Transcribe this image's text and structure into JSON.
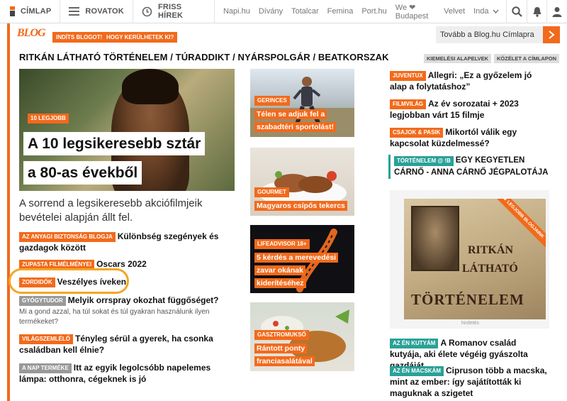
{
  "topnav": {
    "cimlap": "CÍMLAP",
    "rovatok": "ROVATOK",
    "friss": "FRISS HÍREK",
    "sites": [
      "Napi.hu",
      "Dívány",
      "Totalcar",
      "Femina",
      "Port.hu",
      "We ❤ Budapest",
      "Velvet",
      "Inda"
    ]
  },
  "header": {
    "logo": "BLOG",
    "start_blog": "INDÍTS BLOGOT!",
    "how_to": "HOGY KERÜLHETEK KI?",
    "cimlap_link": "Tovább a Blog.hu Címlapra",
    "categories": "RITKÁN LÁTHATÓ TÖRTÉNELEM / TÚRADDIKT / NYÁRSPOLGÁR / BEATKORSZAK",
    "filter1": "KIEMELÉSI ALAPELVEK",
    "filter2": "KÖZÉLET A CÍMLAPON"
  },
  "hero": {
    "tag": "10 LEGJOBB",
    "line1": "A 10 legsikeresebb sztár",
    "line2": "a 80-as évekből",
    "desc": "A sorrend a legsikeresebb akciófilmjeik bevételei alapján állt fel."
  },
  "left_list": [
    {
      "tag": "AZ ANYAGI BIZTONSÁG BLOGJA",
      "title": "Különbség szegények és gazdagok között"
    },
    {
      "tag": "ZUPASTA FILMÉLMÉNYEI",
      "title": "Oscars 2022"
    },
    {
      "tag": "ZORDIDŐK",
      "title": "Veszélyes íveken"
    },
    {
      "tag": "GYÓGYTUDOR",
      "title": "Melyik orrspray okozhat függőséget?",
      "sub": "Mi a gond azzal, ha túl sokat és túl gyakran használunk ilyen termékeket?"
    },
    {
      "tag": "VILÁGSZEMLÉLŐ",
      "title": "Tényleg sérül a gyerek, ha csonka családban kell élnie?"
    },
    {
      "tag": "A NAP TERMÉKE",
      "title": "Itt az egyik legolcsóbb napelemes lámpa: otthonra, cégeknek is jó"
    }
  ],
  "cards": [
    {
      "tag": "GERINCES",
      "title": "Télen se adjuk fel a szabadtéri sportolást!"
    },
    {
      "tag": "GOURMET",
      "title": "Magyaros csípős tekercs"
    },
    {
      "tag": "LIFEADVISOR 18+",
      "title": "5 kérdés a merevedési zavar okának kiderítéséhez"
    },
    {
      "tag": "GASZTROMUKSŐ",
      "title": "Rántott ponty franciasalátával"
    }
  ],
  "right_list": [
    {
      "tag": "JUVENTUX",
      "title": "Allegri: „Ez a győzelem jó alap a folytatáshoz”"
    },
    {
      "tag": "FILMVILÁG",
      "title": "Az év sorozatai + 2023 legjobban várt 15 filmje"
    },
    {
      "tag": "CSAJOK & PASIK",
      "title": "Mikortól válik egy kapcsolat küzdelmessé?"
    }
  ],
  "tortenelem": {
    "tag": "TÖRTÉNELEM @ !B",
    "title": "EGY KEGYETLEN CÁRNŐ - ANNA CÁRNŐ JÉGPALOTÁJA"
  },
  "ad": {
    "ribbon": "★ LEGJOBB BLOGJAINK",
    "word1": "RITKÁN",
    "word2": "LÁTHATÓ",
    "word3": "TÖRTÉNELEM",
    "label": "hirdetés"
  },
  "right_bottom": [
    {
      "tag": "AZ ÉN KUTYÁM",
      "title": "A Romanov család kutyája, aki élete végéig gyászolta gazdáját"
    },
    {
      "tag": "AZ ÉN MACSKÁM",
      "title": "Cipruson több a macska, mint az ember: így sajátították ki maguknak a szigetet"
    }
  ],
  "colors": {
    "accent": "#f26a1b",
    "teal": "#2aa198",
    "highlight": "#f5a623"
  }
}
